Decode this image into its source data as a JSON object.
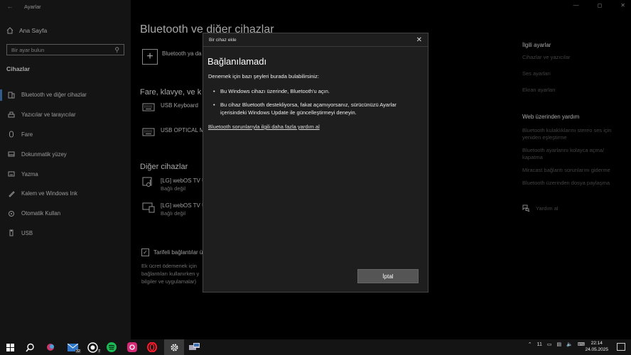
{
  "app": {
    "title": "Ayarlar"
  },
  "sidebar": {
    "home_label": "Ana Sayfa",
    "search_placeholder": "Bir ayar bulun",
    "section_title": "Cihazlar",
    "items": [
      {
        "label": "Bluetooth ve diğer cihazlar",
        "icon": "bluetooth-device-icon",
        "active": true
      },
      {
        "label": "Yazıcılar ve tarayıcılar",
        "icon": "printer-icon",
        "active": false
      },
      {
        "label": "Fare",
        "icon": "mouse-icon",
        "active": false
      },
      {
        "label": "Dokunmatik yüzey",
        "icon": "touchpad-icon",
        "active": false
      },
      {
        "label": "Yazma",
        "icon": "keyboard-icon",
        "active": false
      },
      {
        "label": "Kalem ve Windows Ink",
        "icon": "pen-icon",
        "active": false
      },
      {
        "label": "Otomatik Kullan",
        "icon": "autoplay-icon",
        "active": false
      },
      {
        "label": "USB",
        "icon": "usb-icon",
        "active": false
      }
    ]
  },
  "main": {
    "title": "Bluetooth ve diğer cihazlar",
    "add_device_label": "Bluetooth ya da",
    "input_section": "Fare, klavye, ve k",
    "input_devices": [
      {
        "name": "USB Keyboard",
        "icon": "keyboard-icon"
      },
      {
        "name": "USB OPTICAL MO",
        "icon": "keyboard-icon"
      }
    ],
    "other_section": "Diğer cihazlar",
    "other_devices": [
      {
        "name": "[LG] webOS TV U",
        "status": "Bağlı değil",
        "icon": "media-device-icon"
      },
      {
        "name": "[LG] webOS TV U",
        "status": "Bağlı değil",
        "icon": "display-device-icon"
      }
    ],
    "metered_label": "Tarifeli bağlantılar ü",
    "metered_desc": "Ek ücret ödemenek için bağlantıları kullanırken y bilgiler ve uygulamalar)"
  },
  "related": {
    "title": "İlgili ayarlar",
    "links": [
      "Cihazlar ve yazıcılar",
      "Ses ayarları",
      "Ekran ayarları"
    ]
  },
  "help": {
    "title": "Web üzerinden yardım",
    "links": [
      "Bluetooth kulaklıklarını stereo ses için yeniden eşleştirme",
      "Bluetooth ayarlarını kolayca açma/ kapatma",
      "Miracast bağlantı sorunlarını giderme",
      "Bluetooth üzerinden dosya paylaşma"
    ],
    "get_help": "Yardım al"
  },
  "dialog": {
    "window_title": "Bir cihaz ekle",
    "heading": "Bağlanılamadı",
    "intro": "Denemek için bazı şeyleri burada bulabilirsiniz:",
    "tips": [
      "Bu Windows cihazı üzerinde, Bluetooth'u açın.",
      "Bu cihaz Bluetooth destekliyorsa, fakat açamıyorsanız, sürücünüzü Ayarlar içerisindeki Windows Update ile güncelleştirmeyi deneyin."
    ],
    "link": "Bluetooth sorunlarıyla ilgili daha fazla yardım al",
    "cancel_label": "İptal"
  },
  "taskbar": {
    "mail_badge": "32",
    "whatsapp_badge": "7",
    "tray_count": "11",
    "time": "22:14",
    "date": "24.05.2025"
  },
  "colors": {
    "accent": "#4c8ed4",
    "sidebar_bg": "#1f1f1f",
    "dialog_bg": "#1e1e1e",
    "button_bg": "#555555"
  }
}
